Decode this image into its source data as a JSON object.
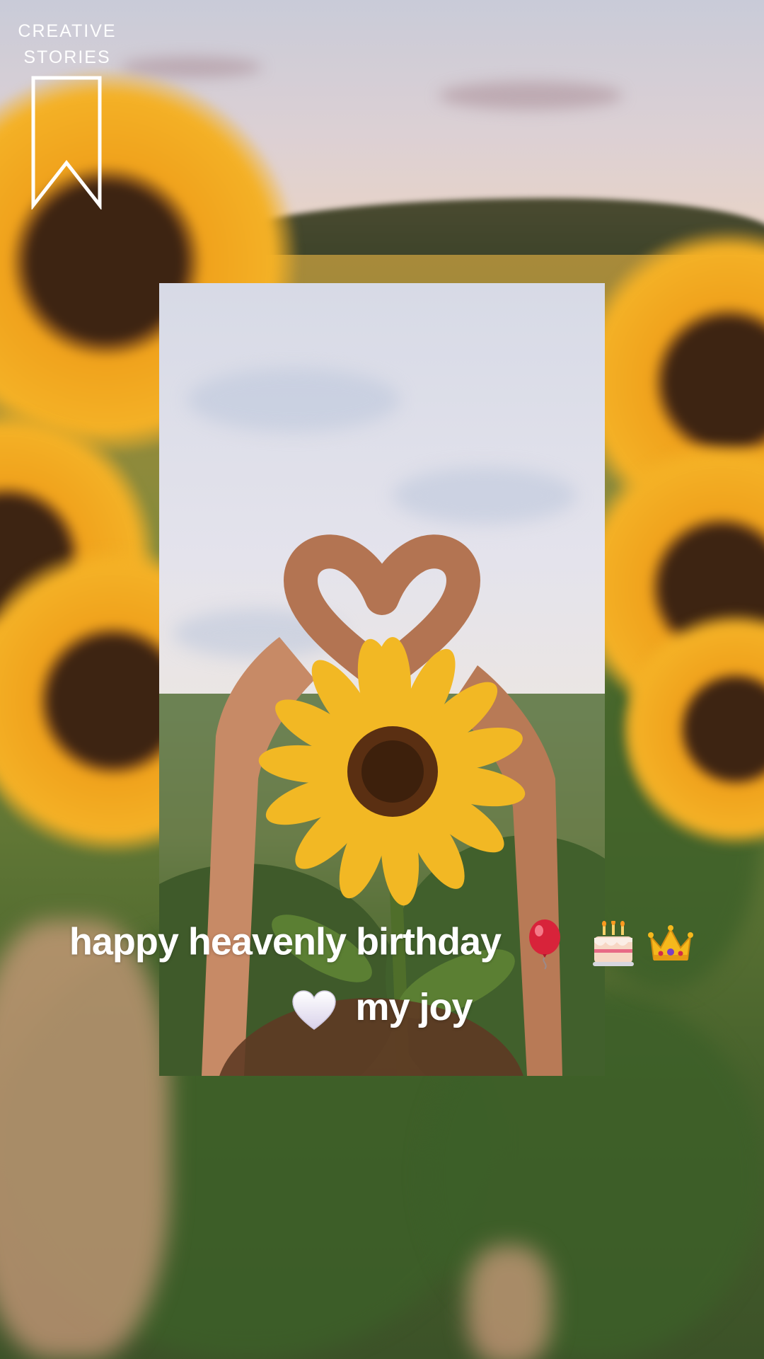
{
  "brand": {
    "line1": "CREATIVE",
    "line2": "STORIES",
    "icon": "bookmark-icon"
  },
  "caption": {
    "line1_text": "happy heavenly birthday",
    "line1_emojis": [
      "balloon-icon",
      "birthday-cake-icon",
      "crown-icon"
    ],
    "line2_text": "my joy",
    "line2_emoji": "white-heart-icon"
  },
  "colors": {
    "text": "#ffffff",
    "sunflower_petal": "#f4b126",
    "sunflower_center": "#3d2412",
    "foliage": "#47622c",
    "sky": "#dcd0d4"
  }
}
